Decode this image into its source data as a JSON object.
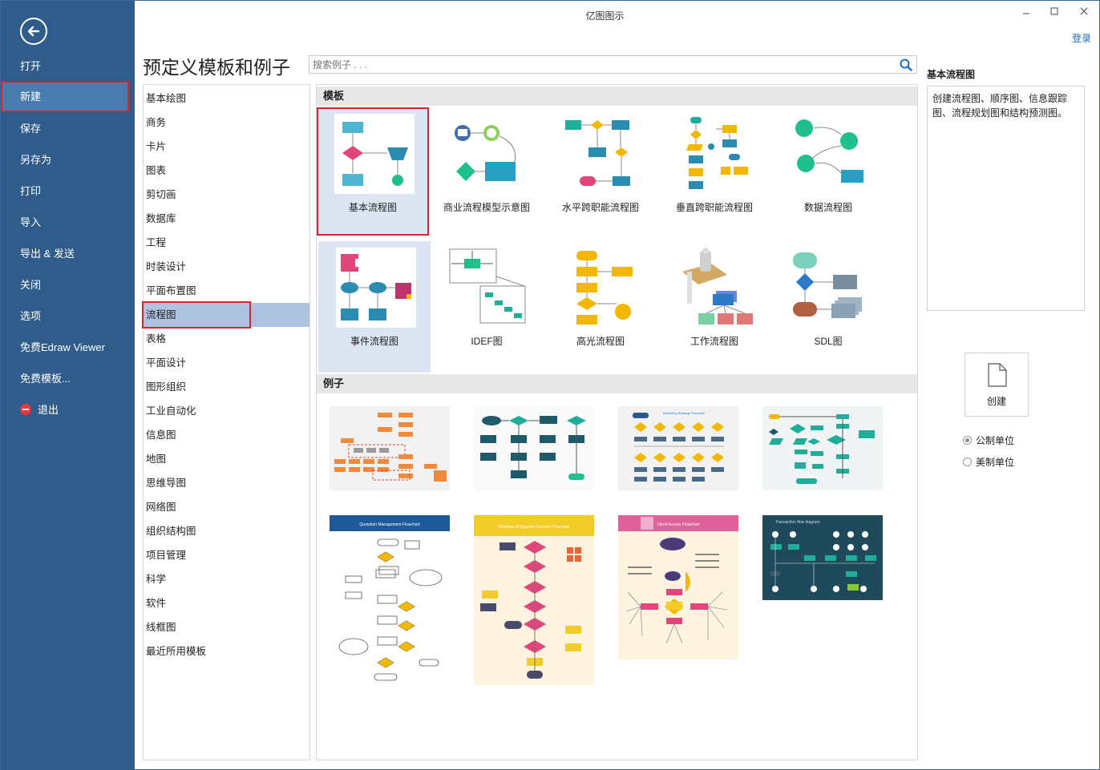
{
  "window": {
    "title": "亿图图示",
    "login": "登录"
  },
  "sidebar": {
    "items": [
      {
        "label": "打开"
      },
      {
        "label": "新建"
      },
      {
        "label": "保存"
      },
      {
        "label": "另存为"
      },
      {
        "label": "打印"
      },
      {
        "label": "导入"
      },
      {
        "label": "导出 & 发送"
      },
      {
        "label": "关闭"
      },
      {
        "label": "选项"
      },
      {
        "label": "免费Edraw Viewer"
      },
      {
        "label": "免费模板..."
      },
      {
        "label": "退出"
      }
    ]
  },
  "header": {
    "title": "预定义模板和例子",
    "search_placeholder": "搜索例子 . . ."
  },
  "categories": [
    "基本绘图",
    "商务",
    "卡片",
    "图表",
    "剪切画",
    "数据库",
    "工程",
    "时装设计",
    "平面布置图",
    "流程图",
    "表格",
    "平面设计",
    "图形组织",
    "工业自动化",
    "信息图",
    "地图",
    "思维导图",
    "网络图",
    "组织结构图",
    "项目管理",
    "科学",
    "软件",
    "线框图",
    "最近所用模板"
  ],
  "gallery": {
    "templates_heading": "模板",
    "examples_heading": "例子",
    "templates": [
      {
        "label": "基本流程图"
      },
      {
        "label": "商业流程模型示意图"
      },
      {
        "label": "水平跨职能流程图"
      },
      {
        "label": "垂直跨职能流程图"
      },
      {
        "label": "数据流程图"
      },
      {
        "label": "事件流程图"
      },
      {
        "label": "IDEF图"
      },
      {
        "label": "高光流程图"
      },
      {
        "label": "工作流程图"
      },
      {
        "label": "SDL图"
      }
    ],
    "examples": [
      {
        "title": ""
      },
      {
        "title": ""
      },
      {
        "title": "Marketing Strategy Flowchart"
      },
      {
        "title": ""
      },
      {
        "title": "Quotation Management Flowchart"
      },
      {
        "title": "Windows 8 Upgrade Decision Flowchart"
      },
      {
        "title": "Client Access Flowchart"
      },
      {
        "title": "Transaction flow diagram"
      }
    ]
  },
  "right_panel": {
    "title": "基本流程图",
    "description": "创建流程图、顺序图、信息跟踪图、流程规划图和结构预测图。",
    "create_label": "创建",
    "units": [
      {
        "label": "公制单位",
        "checked": true
      },
      {
        "label": "美制单位",
        "checked": false
      }
    ]
  },
  "colors": {
    "sidebar": "#2f5c8a",
    "accent_red": "#e0202a",
    "selected_bg": "#dbe6f2",
    "cat_selected": "#aec3e0"
  }
}
